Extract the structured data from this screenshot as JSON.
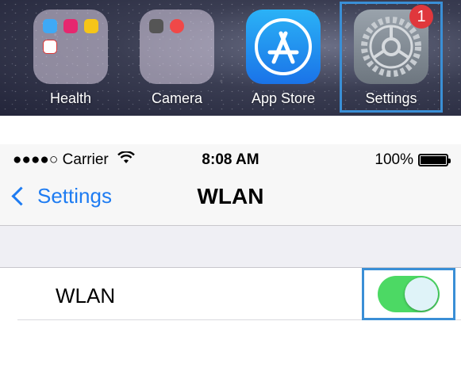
{
  "home": {
    "apps": [
      {
        "label": "Health"
      },
      {
        "label": "Camera"
      },
      {
        "label": "App Store"
      },
      {
        "label": "Settings",
        "badge": "1"
      }
    ]
  },
  "status": {
    "carrier": "●●●●○ Carrier",
    "time": "8:08 AM",
    "battery": "100%"
  },
  "nav": {
    "back_label": "Settings",
    "title": "WLAN"
  },
  "wlan_row": {
    "label": "WLAN",
    "toggle_on": true
  },
  "colors": {
    "accent": "#1e7cf2",
    "toggle_on": "#4cd964",
    "selection": "#3a8fd6",
    "badge": "#e0373c"
  }
}
